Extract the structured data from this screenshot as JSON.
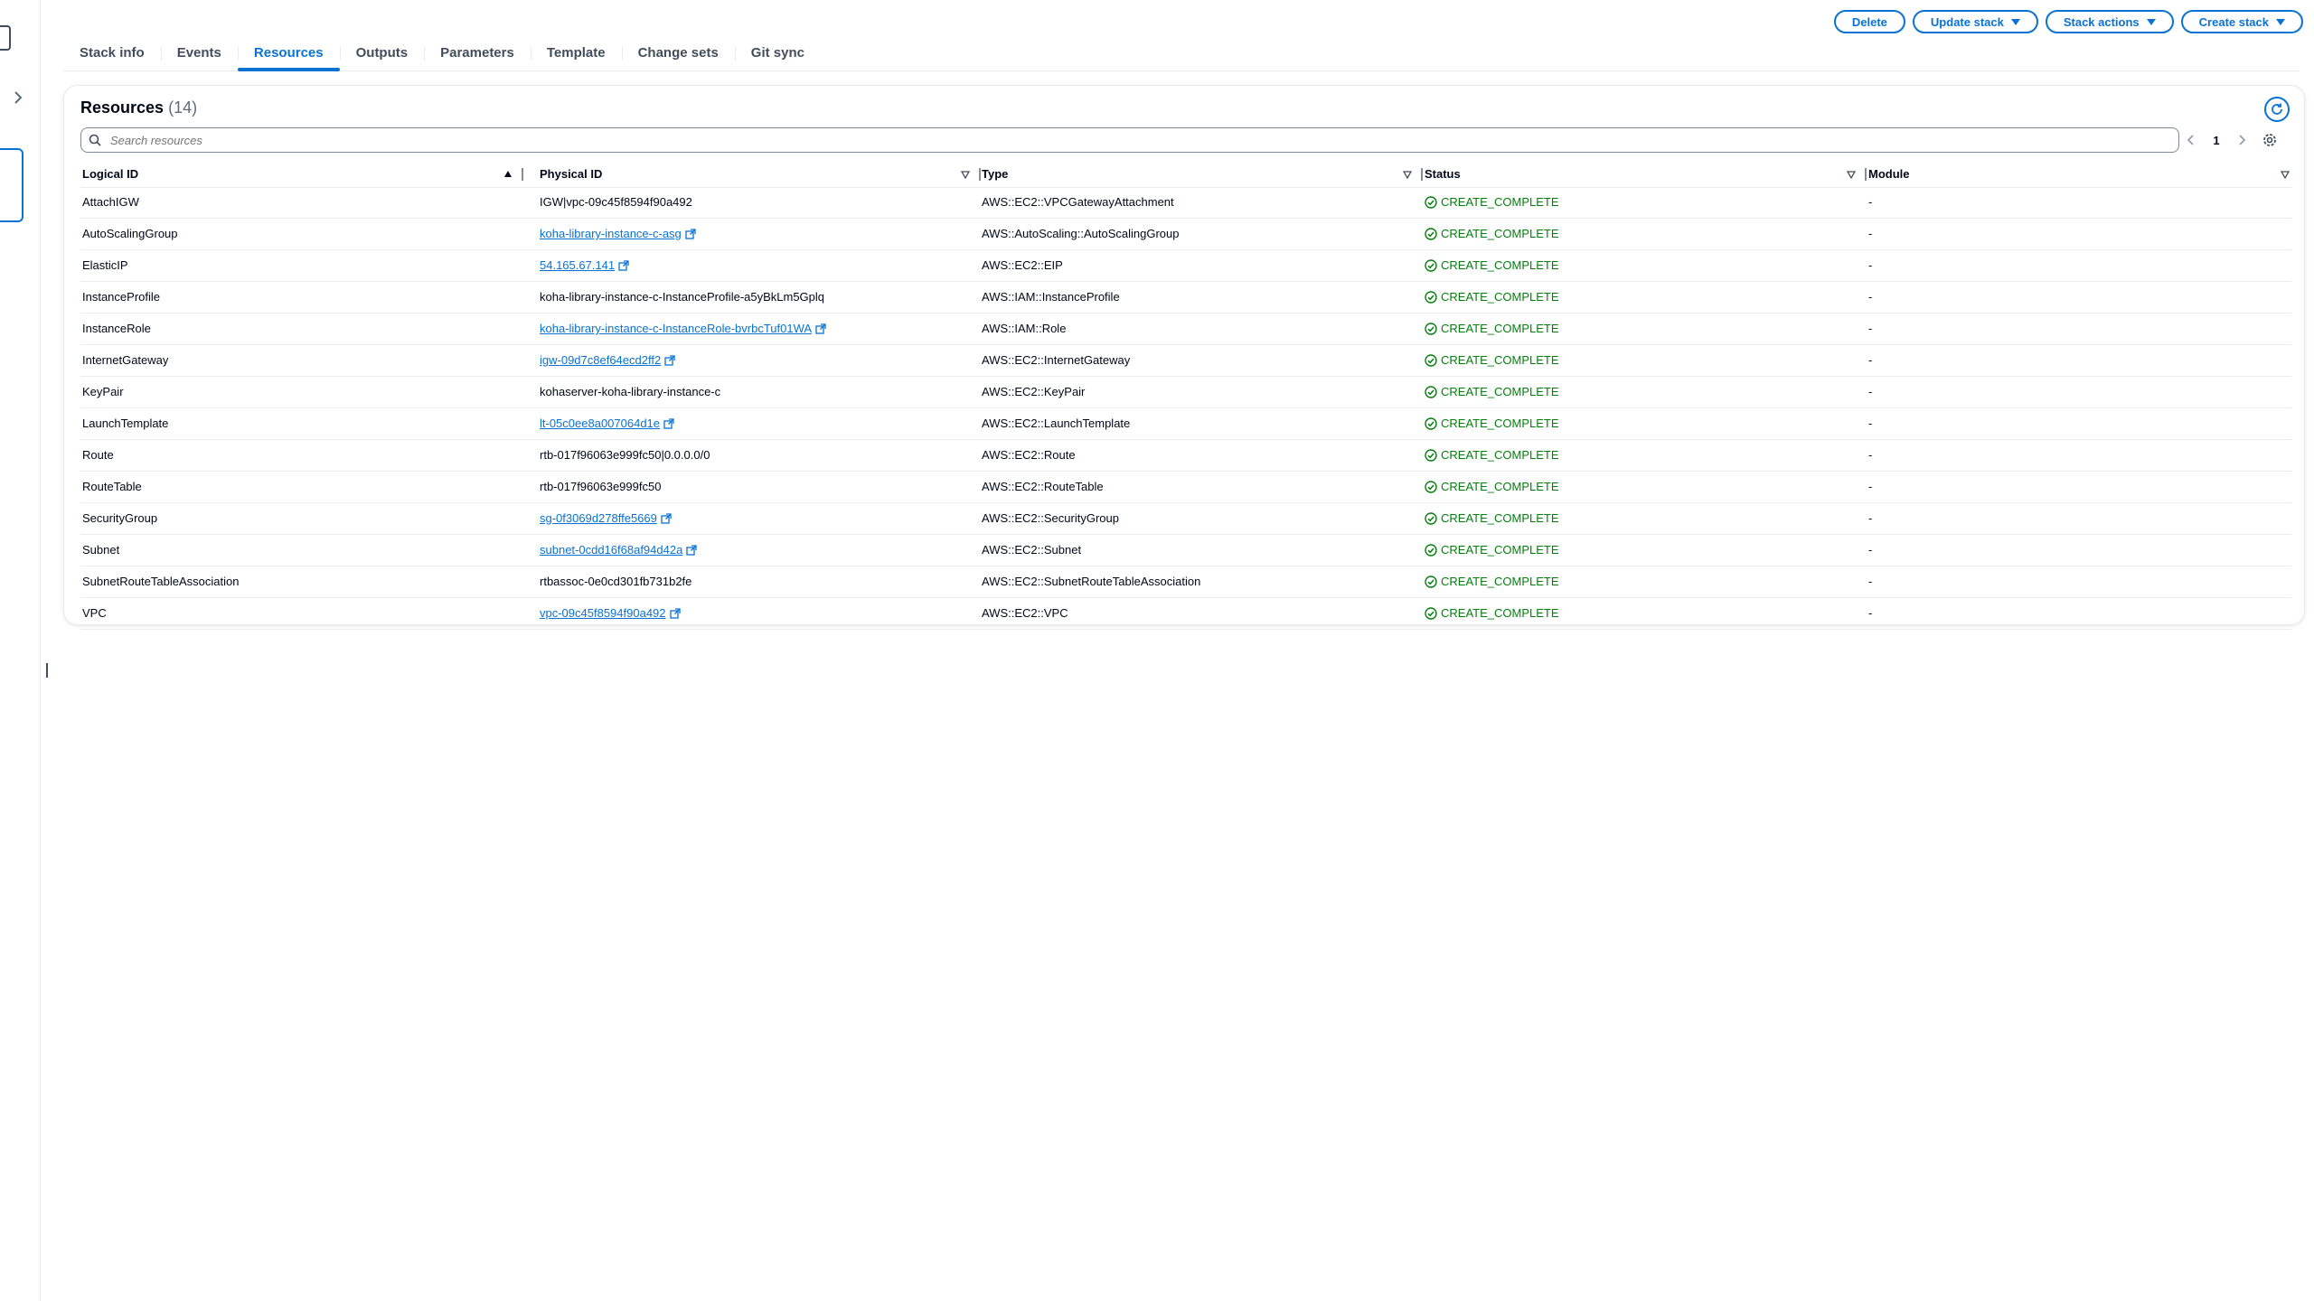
{
  "tabs": [
    {
      "label": "Stack info"
    },
    {
      "label": "Events"
    },
    {
      "label": "Resources",
      "active": true
    },
    {
      "label": "Outputs"
    },
    {
      "label": "Parameters"
    },
    {
      "label": "Template"
    },
    {
      "label": "Change sets"
    },
    {
      "label": "Git sync"
    }
  ],
  "actions": {
    "delete": "Delete",
    "update_stack": "Update stack",
    "stack_actions": "Stack actions",
    "create_stack": "Create stack"
  },
  "resources": {
    "title": "Resources",
    "count": "(14)",
    "search_placeholder": "Search resources",
    "page": "1",
    "columns": [
      "Logical ID",
      "Physical ID",
      "Type",
      "Status",
      "Module"
    ],
    "rows": [
      {
        "logical_id": "AttachIGW",
        "physical_id": "IGW|vpc-09c45f8594f90a492",
        "physical_link": false,
        "type": "AWS::EC2::VPCGatewayAttachment",
        "status": "CREATE_COMPLETE",
        "module": "-"
      },
      {
        "logical_id": "AutoScalingGroup",
        "physical_id": "koha-library-instance-c-asg",
        "physical_link": true,
        "type": "AWS::AutoScaling::AutoScalingGroup",
        "status": "CREATE_COMPLETE",
        "module": "-"
      },
      {
        "logical_id": "ElasticIP",
        "physical_id": "54.165.67.141",
        "physical_link": true,
        "type": "AWS::EC2::EIP",
        "status": "CREATE_COMPLETE",
        "module": "-"
      },
      {
        "logical_id": "InstanceProfile",
        "physical_id": "koha-library-instance-c-InstanceProfile-a5yBkLm5Gplq",
        "physical_link": false,
        "type": "AWS::IAM::InstanceProfile",
        "status": "CREATE_COMPLETE",
        "module": "-"
      },
      {
        "logical_id": "InstanceRole",
        "physical_id": "koha-library-instance-c-InstanceRole-bvrbcTuf01WA",
        "physical_link": true,
        "type": "AWS::IAM::Role",
        "status": "CREATE_COMPLETE",
        "module": "-"
      },
      {
        "logical_id": "InternetGateway",
        "physical_id": "igw-09d7c8ef64ecd2ff2",
        "physical_link": true,
        "type": "AWS::EC2::InternetGateway",
        "status": "CREATE_COMPLETE",
        "module": "-"
      },
      {
        "logical_id": "KeyPair",
        "physical_id": "kohaserver-koha-library-instance-c",
        "physical_link": false,
        "type": "AWS::EC2::KeyPair",
        "status": "CREATE_COMPLETE",
        "module": "-"
      },
      {
        "logical_id": "LaunchTemplate",
        "physical_id": "lt-05c0ee8a007064d1e",
        "physical_link": true,
        "type": "AWS::EC2::LaunchTemplate",
        "status": "CREATE_COMPLETE",
        "module": "-"
      },
      {
        "logical_id": "Route",
        "physical_id": "rtb-017f96063e999fc50|0.0.0.0/0",
        "physical_link": false,
        "type": "AWS::EC2::Route",
        "status": "CREATE_COMPLETE",
        "module": "-"
      },
      {
        "logical_id": "RouteTable",
        "physical_id": "rtb-017f96063e999fc50",
        "physical_link": false,
        "type": "AWS::EC2::RouteTable",
        "status": "CREATE_COMPLETE",
        "module": "-"
      },
      {
        "logical_id": "SecurityGroup",
        "physical_id": "sg-0f3069d278ffe5669",
        "physical_link": true,
        "type": "AWS::EC2::SecurityGroup",
        "status": "CREATE_COMPLETE",
        "module": "-"
      },
      {
        "logical_id": "Subnet",
        "physical_id": "subnet-0cdd16f68af94d42a",
        "physical_link": true,
        "type": "AWS::EC2::Subnet",
        "status": "CREATE_COMPLETE",
        "module": "-"
      },
      {
        "logical_id": "SubnetRouteTableAssociation",
        "physical_id": "rtbassoc-0e0cd301fb731b2fe",
        "physical_link": false,
        "type": "AWS::EC2::SubnetRouteTableAssociation",
        "status": "CREATE_COMPLETE",
        "module": "-"
      },
      {
        "logical_id": "VPC",
        "physical_id": "vpc-09c45f8594f90a492",
        "physical_link": true,
        "type": "AWS::EC2::VPC",
        "status": "CREATE_COMPLETE",
        "module": "-"
      }
    ]
  },
  "colors": {
    "link": "#0972d3",
    "success": "#037f0c",
    "border": "#e9ebed"
  },
  "icons": [
    "chevron-right-icon",
    "search-icon",
    "refresh-icon",
    "chevron-left-icon",
    "settings-gear-icon",
    "sort-ascending-icon",
    "sort-descending-icon",
    "external-link-icon",
    "success-check-icon",
    "caret-down-icon"
  ]
}
